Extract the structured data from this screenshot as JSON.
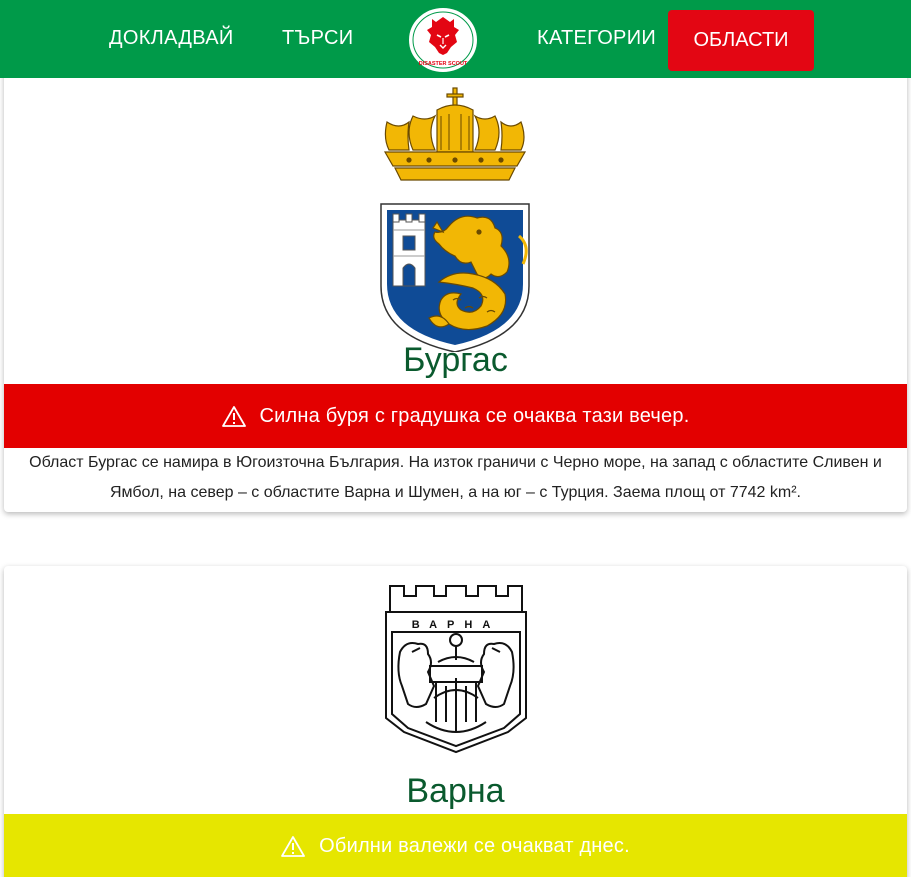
{
  "nav": {
    "report_label": "ДОКЛАДВАЙ",
    "search_label": "ТЪРСИ",
    "categories_label": "КАТЕГОРИИ",
    "regions_label": "ОБЛАСТИ",
    "logo_text": "DISASTER SCOUT"
  },
  "colors": {
    "navbar": "#009a49",
    "active_nav": "#e30613",
    "alert_red": "#e30000",
    "alert_yellow": "#e6e600",
    "region_title": "#0a5a2e"
  },
  "regions": [
    {
      "name": "Бургас",
      "crest_icon": "burgas-coat-of-arms",
      "alert_icon": "warning-triangle-icon",
      "alert_text": "Силна буря с градушка се очаква тази вечер.",
      "alert_level": "red",
      "description": "Област Бургас се намира в Югоизточна България. На изток граничи с Черно море, на запад с областите Сливен и Ямбол, на север – с областите Варна и Шумен, а на юг – с Турция. Заема площ от 7742 km²."
    },
    {
      "name": "Варна",
      "crest_icon": "varna-coat-of-arms",
      "crest_text": "ВАРНА",
      "alert_icon": "warning-triangle-icon",
      "alert_text": "Обилни валежи се очакват днес.",
      "alert_level": "yellow"
    }
  ]
}
